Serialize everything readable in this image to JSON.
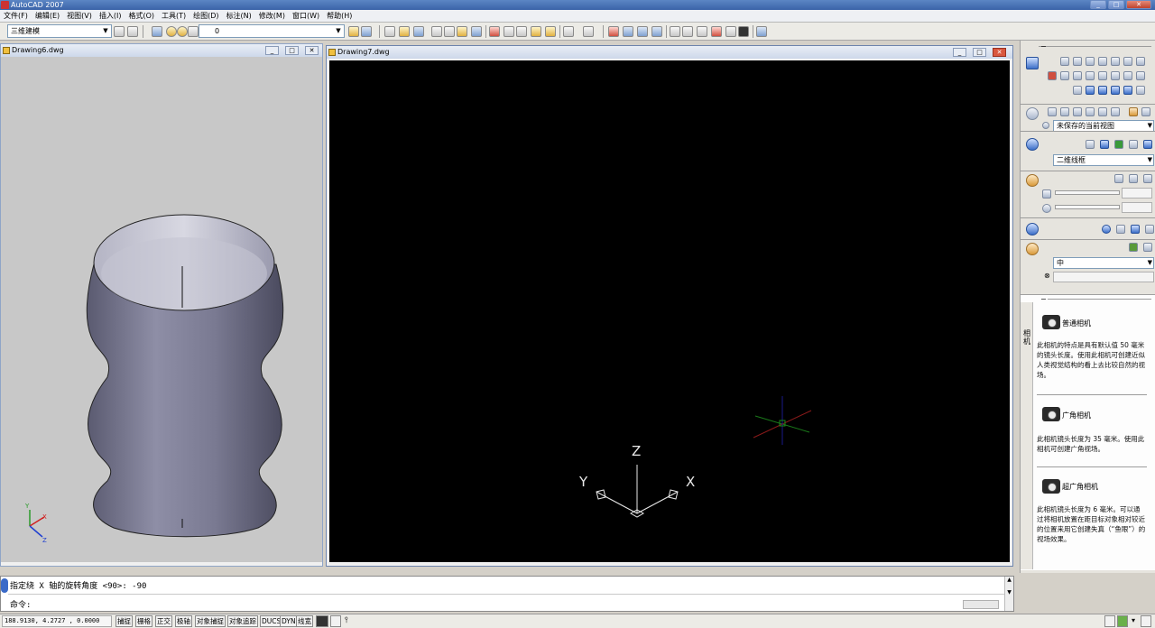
{
  "app": {
    "title": "AutoCAD 2007"
  },
  "menu": [
    "文件(F)",
    "编辑(E)",
    "视图(V)",
    "插入(I)",
    "格式(O)",
    "工具(T)",
    "绘图(D)",
    "标注(N)",
    "修改(M)",
    "窗口(W)",
    "帮助(H)"
  ],
  "toolbar": {
    "workspace": "三维建模",
    "layer": "0"
  },
  "windows": {
    "left": {
      "title": "Drawing6.dwg"
    },
    "main": {
      "title": "Drawing7.dwg"
    }
  },
  "axes": {
    "x": "X",
    "y": "Y",
    "z": "Z"
  },
  "panel": {
    "view_combo": "未保存的当前视图",
    "visual_style": "二维线框",
    "light_combo": "中"
  },
  "palette": {
    "tab": "相机",
    "cameras": [
      {
        "title": "普通相机",
        "desc": "此相机的特点是具有默认值 50 毫米的镜头长度。使用此相机可创建近似人类视觉结构的看上去比较自然的视场。"
      },
      {
        "title": "广角相机",
        "desc": "此相机镜头长度为 35 毫米。使用此相机可创建广角视场。"
      },
      {
        "title": "超广角相机",
        "desc": "此相机镜头长度为 6 毫米。可以通过将相机放置在距目标对象相对较近的位置来用它创建失真（“鱼眼”）的视场效果。"
      }
    ]
  },
  "command": {
    "history": "指定绕 X 轴的旋转角度 <90>: -90",
    "prompt": "命令:"
  },
  "status": {
    "coords": "188.9130,  4.2727  , 0.0000",
    "buttons": [
      "捕捉",
      "栅格",
      "正交",
      "极轴",
      "对象捕捉",
      "对象追踪",
      "DUCS",
      "DYN",
      "线宽"
    ]
  }
}
